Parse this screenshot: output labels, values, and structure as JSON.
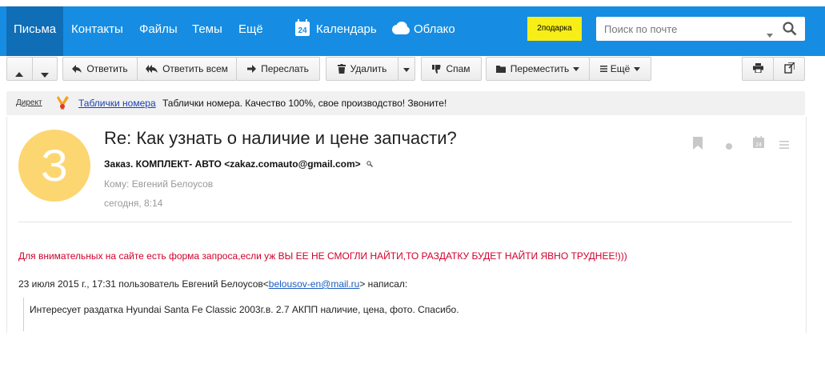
{
  "nav": {
    "items": [
      {
        "label": "Письма",
        "active": true
      },
      {
        "label": "Контакты"
      },
      {
        "label": "Файлы"
      },
      {
        "label": "Темы"
      },
      {
        "label": "Ещё"
      }
    ],
    "calendar_label": "Календарь",
    "calendar_day": "24",
    "cloud_label": "Облако",
    "gift_label": "2подарка",
    "search_placeholder": "Поиск по почте"
  },
  "toolbar": {
    "reply": "Ответить",
    "reply_all": "Ответить всем",
    "forward": "Переслать",
    "delete": "Удалить",
    "spam": "Спам",
    "move": "Переместить",
    "more": "Ещё"
  },
  "direct": {
    "label": "Директ",
    "link": "Таблички номера",
    "text": "Таблички номера. Качество 100%, свое производство! Звоните!"
  },
  "message": {
    "avatar_letter": "З",
    "subject": "Re: Как узнать о наличие и цене запчасти?",
    "sender": "Заказ. КОМПЛЕКТ- АВТО <zakaz.comauto@gmail.com>",
    "to": "Кому: Евгений Белоусов",
    "date": "сегодня, 8:14",
    "calendar_day": "24",
    "body": "Для внимательных на сайте есть форма запроса,если уж ВЫ ЕЕ НЕ СМОГЛИ НАЙТИ,ТО РАЗДАТКУ БУДЕТ НАЙТИ ЯВНО ТРУДНЕЕ!)))",
    "quote_prefix": "23 июля 2015 г., 17:31 пользователь Евгений Белоусов<",
    "quote_email": "belousov-en@mail.ru",
    "quote_suffix": "> написал:",
    "quote_text": "Интересует раздатка Hyundai Santa Fe Classic 2003г.в. 2.7 АКПП наличие, цена, фото. Спасибо."
  },
  "colors": {
    "brand_blue": "#168de2",
    "active_tab": "#0f6eb6",
    "gift_yellow": "#f6ee16",
    "avatar_yellow": "#fcd671",
    "body_red": "#d0002b"
  }
}
